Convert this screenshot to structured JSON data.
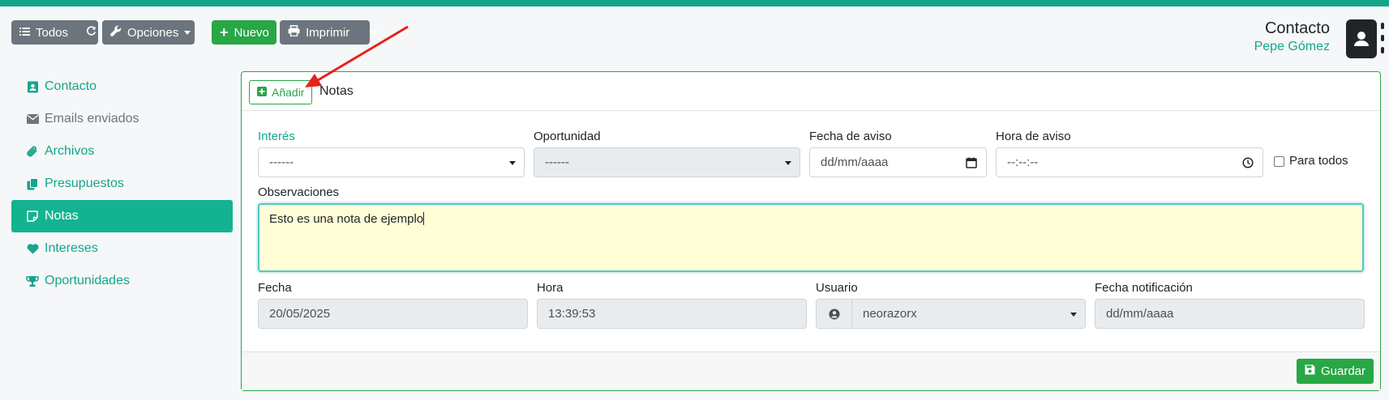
{
  "toolbar": {
    "todos_label": "Todos",
    "opciones_label": "Opciones",
    "nuevo_label": "Nuevo",
    "imprimir_label": "Imprimir"
  },
  "header": {
    "title": "Contacto",
    "subtitle": "Pepe Gómez",
    "icon": "address-book-icon"
  },
  "sidebar": {
    "items": [
      {
        "label": "Contacto",
        "icon": "address-card-icon",
        "state": "link"
      },
      {
        "label": "Emails enviados",
        "icon": "envelope-icon",
        "state": "muted"
      },
      {
        "label": "Archivos",
        "icon": "paperclip-icon",
        "state": "link"
      },
      {
        "label": "Presupuestos",
        "icon": "copy-icon",
        "state": "link"
      },
      {
        "label": "Notas",
        "icon": "sticky-note-icon",
        "state": "active"
      },
      {
        "label": "Intereses",
        "icon": "heart-icon",
        "state": "link"
      },
      {
        "label": "Oportunidades",
        "icon": "trophy-icon",
        "state": "link"
      }
    ]
  },
  "card": {
    "add_label": "Añadir",
    "title": "Notas",
    "save_label": "Guardar"
  },
  "form": {
    "interes": {
      "label": "Interés",
      "value": "------"
    },
    "oportunidad": {
      "label": "Oportunidad",
      "value": "------"
    },
    "fecha_aviso": {
      "label": "Fecha de aviso",
      "placeholder": "dd/mm/aaaa"
    },
    "hora_aviso": {
      "label": "Hora de aviso",
      "placeholder": "--:--:--"
    },
    "para_todos": {
      "label": "Para todos",
      "checked": false
    },
    "observaciones": {
      "label": "Observaciones",
      "value": "Esto es una nota de ejemplo"
    },
    "fecha": {
      "label": "Fecha",
      "value": "20/05/2025"
    },
    "hora": {
      "label": "Hora",
      "value": "13:39:53"
    },
    "usuario": {
      "label": "Usuario",
      "value": "neorazorx"
    },
    "fecha_notificacion": {
      "label": "Fecha notificación",
      "placeholder": "dd/mm/aaaa"
    }
  },
  "colors": {
    "accent": "#15a58a",
    "active_bg": "#14b38f",
    "success": "#28a745",
    "secondary": "#6c757d",
    "annotation_arrow": "#e8201c"
  }
}
